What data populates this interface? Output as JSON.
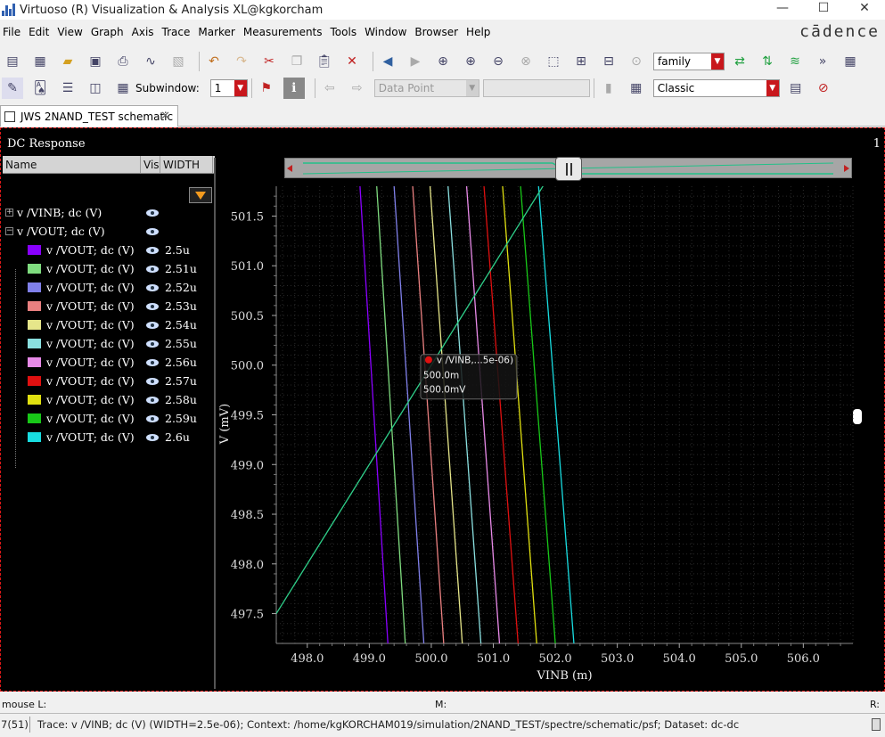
{
  "window": {
    "title": "Virtuoso (R) Visualization & Analysis XL@kgkorcham",
    "minimize": "—",
    "maximize": "☐",
    "close": "✕"
  },
  "menu": [
    "File",
    "Edit",
    "View",
    "Graph",
    "Axis",
    "Trace",
    "Marker",
    "Measurements",
    "Tools",
    "Window",
    "Browser",
    "Help"
  ],
  "brand": "cādence",
  "toolbar1": {
    "family_combo": "family"
  },
  "toolbar2": {
    "subwindow_label": "Subwindow:",
    "subwindow_value": "1",
    "marker_combo": "Data Point",
    "style_combo": "Classic"
  },
  "tab": {
    "label": "JWS 2NAND_TEST schematic",
    "close": "✕"
  },
  "panel": {
    "title": "DC Response",
    "page_number": "1"
  },
  "trace_list": {
    "headers": {
      "name": "Name",
      "vis": "Vis",
      "width": "WIDTH"
    },
    "groups": [
      {
        "expander": "+",
        "name": "v /VINB; dc (V)"
      },
      {
        "expander": "−",
        "name": "v /VOUT; dc (V)"
      }
    ],
    "traces": [
      {
        "name": "v /VOUT; dc (V)",
        "width": "2.5u",
        "color": "#8a00ff"
      },
      {
        "name": "v /VOUT; dc (V)",
        "width": "2.51u",
        "color": "#7fdc7f"
      },
      {
        "name": "v /VOUT; dc (V)",
        "width": "2.52u",
        "color": "#8080ea"
      },
      {
        "name": "v /VOUT; dc (V)",
        "width": "2.53u",
        "color": "#ea8080"
      },
      {
        "name": "v /VOUT; dc (V)",
        "width": "2.54u",
        "color": "#e6e68a"
      },
      {
        "name": "v /VOUT; dc (V)",
        "width": "2.55u",
        "color": "#8ae0e0"
      },
      {
        "name": "v /VOUT; dc (V)",
        "width": "2.56u",
        "color": "#e88ae8"
      },
      {
        "name": "v /VOUT; dc (V)",
        "width": "2.57u",
        "color": "#e01010"
      },
      {
        "name": "v /VOUT; dc (V)",
        "width": "2.58u",
        "color": "#e0e010"
      },
      {
        "name": "v /VOUT; dc (V)",
        "width": "2.59u",
        "color": "#18c818"
      },
      {
        "name": "v /VOUT; dc (V)",
        "width": "2.6u",
        "color": "#18dce0"
      }
    ]
  },
  "chart_data": {
    "type": "line",
    "xlabel": "VINB (m)",
    "ylabel": "V (mV)",
    "xlim": [
      497.5,
      506.8
    ],
    "ylim": [
      497.2,
      501.8
    ],
    "x_ticks": [
      "498.0",
      "499.0",
      "500.0",
      "501.0",
      "502.0",
      "503.0",
      "504.0",
      "505.0",
      "506.0"
    ],
    "y_ticks": [
      "497.5",
      "498.0",
      "498.5",
      "499.0",
      "499.5",
      "500.0",
      "500.5",
      "501.0",
      "501.5"
    ],
    "grid": true,
    "vinb_series": {
      "color": "#2fd08a",
      "x": [
        497.5,
        501.85
      ],
      "y": [
        497.5,
        501.85
      ]
    },
    "vout_series": [
      {
        "color": "#8a00ff",
        "x": [
          498.85,
          499.3
        ],
        "y": [
          501.8,
          497.2
        ]
      },
      {
        "color": "#7fdc7f",
        "x": [
          499.12,
          499.58
        ],
        "y": [
          501.8,
          497.2
        ]
      },
      {
        "color": "#8080ea",
        "x": [
          499.4,
          499.88
        ],
        "y": [
          501.8,
          497.2
        ]
      },
      {
        "color": "#ea8080",
        "x": [
          499.7,
          500.2
        ],
        "y": [
          501.8,
          497.2
        ]
      },
      {
        "color": "#e6e68a",
        "x": [
          499.98,
          500.5
        ],
        "y": [
          501.8,
          497.2
        ]
      },
      {
        "color": "#8ae0e0",
        "x": [
          500.27,
          500.8
        ],
        "y": [
          501.8,
          497.2
        ]
      },
      {
        "color": "#e88ae8",
        "x": [
          500.57,
          501.1
        ],
        "y": [
          501.8,
          497.2
        ]
      },
      {
        "color": "#e01010",
        "x": [
          500.85,
          501.4
        ],
        "y": [
          501.8,
          497.2
        ]
      },
      {
        "color": "#e0e010",
        "x": [
          501.15,
          501.7
        ],
        "y": [
          501.8,
          497.2
        ]
      },
      {
        "color": "#18c818",
        "x": [
          501.44,
          502.0
        ],
        "y": [
          501.8,
          497.2
        ]
      },
      {
        "color": "#18dce0",
        "x": [
          501.73,
          502.3
        ],
        "y": [
          501.8,
          497.2
        ]
      }
    ],
    "marker": {
      "x": 500.0,
      "y": 500.0,
      "label": "v /VINB,...5e-06)",
      "x_readout": "500.0m",
      "y_readout": "500.0mV"
    }
  },
  "status": {
    "mouse_l": "mouse L:",
    "mouse_m": "M:",
    "mouse_r": "R:"
  },
  "info": {
    "count": "7(51)",
    "message": "Trace: v /VINB; dc (V) (WIDTH=2.5e-06); Context: /home/kgKORCHAM019/simulation/2NAND_TEST/spectre/schematic/psf; Dataset: dc-dc"
  }
}
